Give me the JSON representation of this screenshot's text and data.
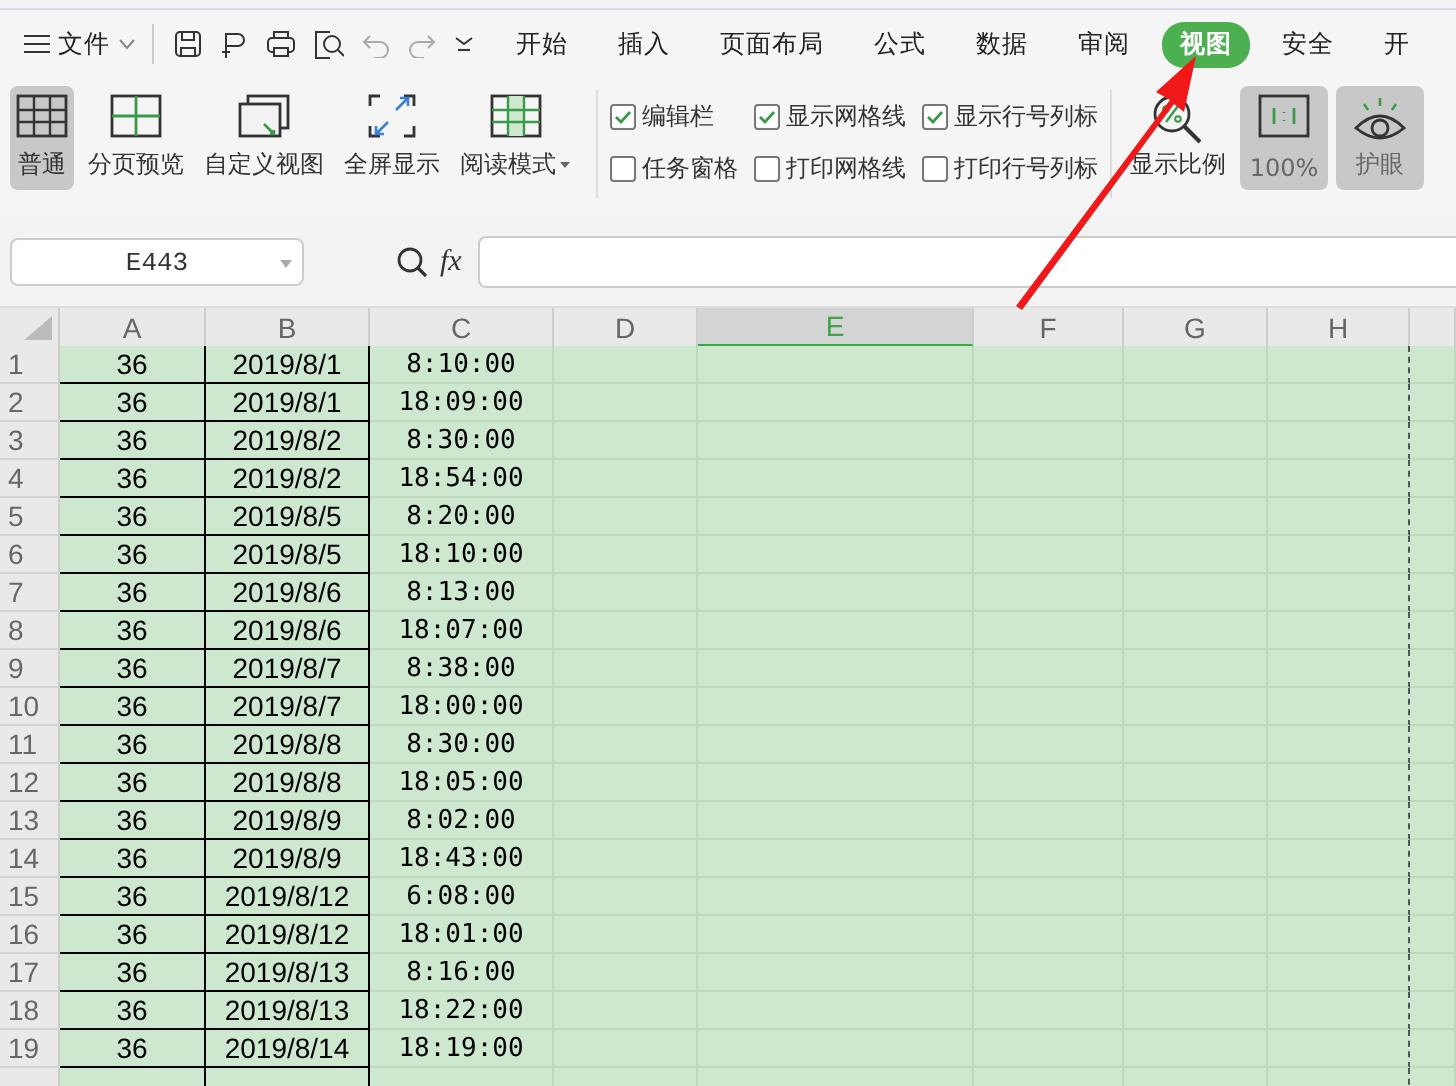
{
  "menu": {
    "file_label": "文件",
    "tabs": [
      {
        "label": "开始",
        "selected": false
      },
      {
        "label": "插入",
        "selected": false
      },
      {
        "label": "页面布局",
        "selected": false
      },
      {
        "label": "公式",
        "selected": false
      },
      {
        "label": "数据",
        "selected": false
      },
      {
        "label": "审阅",
        "selected": false
      },
      {
        "label": "视图",
        "selected": true
      },
      {
        "label": "安全",
        "selected": false
      },
      {
        "label": "开",
        "selected": false
      }
    ]
  },
  "ribbon": {
    "view_buttons": [
      {
        "kind": "normal",
        "label": "普通",
        "selected": true,
        "dropdown": false
      },
      {
        "kind": "page-break",
        "label": "分页预览",
        "selected": false,
        "dropdown": false
      },
      {
        "kind": "custom",
        "label": "自定义视图",
        "selected": false,
        "dropdown": false
      },
      {
        "kind": "fullscreen",
        "label": "全屏显示",
        "selected": false,
        "dropdown": false
      },
      {
        "kind": "reading",
        "label": "阅读模式",
        "selected": false,
        "dropdown": true
      }
    ],
    "checkboxes": [
      {
        "label": "编辑栏",
        "checked": true
      },
      {
        "label": "任务窗格",
        "checked": false
      },
      {
        "label": "显示网格线",
        "checked": true
      },
      {
        "label": "打印网格线",
        "checked": false
      },
      {
        "label": "显示行号列标",
        "checked": true
      },
      {
        "label": "打印行号列标",
        "checked": false
      }
    ],
    "zoom_buttons": [
      {
        "kind": "zoom",
        "label": "显示比例",
        "selected": false
      },
      {
        "kind": "actual",
        "label": "100%",
        "selected": true
      },
      {
        "kind": "eye",
        "label": "护眼",
        "selected": true
      }
    ]
  },
  "formula_bar": {
    "name_box": "E443",
    "fx": "fx"
  },
  "sheet": {
    "columns": [
      {
        "label": "A",
        "selected": false
      },
      {
        "label": "B",
        "selected": false
      },
      {
        "label": "C",
        "selected": false
      },
      {
        "label": "D",
        "selected": false
      },
      {
        "label": "E",
        "selected": true
      },
      {
        "label": "F",
        "selected": false
      },
      {
        "label": "G",
        "selected": false
      },
      {
        "label": "H",
        "selected": false
      }
    ],
    "rows": [
      {
        "number": "1",
        "cells": [
          "36",
          "2019/8/1",
          "8:10:00"
        ]
      },
      {
        "number": "2",
        "cells": [
          "36",
          "2019/8/1",
          "18:09:00"
        ]
      },
      {
        "number": "3",
        "cells": [
          "36",
          "2019/8/2",
          "8:30:00"
        ]
      },
      {
        "number": "4",
        "cells": [
          "36",
          "2019/8/2",
          "18:54:00"
        ]
      },
      {
        "number": "5",
        "cells": [
          "36",
          "2019/8/5",
          "8:20:00"
        ]
      },
      {
        "number": "6",
        "cells": [
          "36",
          "2019/8/5",
          "18:10:00"
        ]
      },
      {
        "number": "7",
        "cells": [
          "36",
          "2019/8/6",
          "8:13:00"
        ]
      },
      {
        "number": "8",
        "cells": [
          "36",
          "2019/8/6",
          "18:07:00"
        ]
      },
      {
        "number": "9",
        "cells": [
          "36",
          "2019/8/7",
          "8:38:00"
        ]
      },
      {
        "number": "10",
        "cells": [
          "36",
          "2019/8/7",
          "18:00:00"
        ]
      },
      {
        "number": "11",
        "cells": [
          "36",
          "2019/8/8",
          "8:30:00"
        ]
      },
      {
        "number": "12",
        "cells": [
          "36",
          "2019/8/8",
          "18:05:00"
        ]
      },
      {
        "number": "13",
        "cells": [
          "36",
          "2019/8/9",
          "8:02:00"
        ]
      },
      {
        "number": "14",
        "cells": [
          "36",
          "2019/8/9",
          "18:43:00"
        ]
      },
      {
        "number": "15",
        "cells": [
          "36",
          "2019/8/12",
          "6:08:00"
        ]
      },
      {
        "number": "16",
        "cells": [
          "36",
          "2019/8/12",
          "18:01:00"
        ]
      },
      {
        "number": "17",
        "cells": [
          "36",
          "2019/8/13",
          "8:16:00"
        ]
      },
      {
        "number": "18",
        "cells": [
          "36",
          "2019/8/13",
          "18:22:00"
        ]
      },
      {
        "number": "19",
        "cells": [
          "36",
          "2019/8/14",
          "18:19:00"
        ]
      }
    ]
  }
}
